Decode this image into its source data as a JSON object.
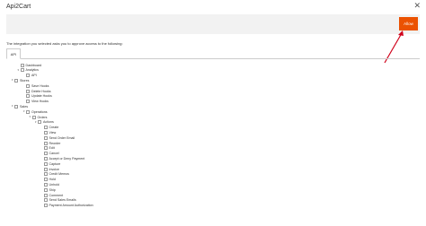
{
  "modal": {
    "title": "Api2Cart",
    "close_glyph": "✕"
  },
  "actions": {
    "allow_label": "Allow"
  },
  "intro_text": "The integration you selected asks you to approve access to the following:",
  "tabs": [
    {
      "label": "API"
    }
  ],
  "tree": [
    {
      "label": "Dashboard",
      "level": 1,
      "caret": false
    },
    {
      "label": "Analytics",
      "level": 1,
      "caret": true
    },
    {
      "label": "API",
      "level": 2,
      "caret": false
    },
    {
      "label": "Stores",
      "level": 0,
      "caret": true
    },
    {
      "label": "Save Hooks",
      "level": 2,
      "caret": false
    },
    {
      "label": "Delete Hooks",
      "level": 2,
      "caret": false
    },
    {
      "label": "Update Hooks",
      "level": 2,
      "caret": false
    },
    {
      "label": "View Hooks",
      "level": 2,
      "caret": false
    },
    {
      "label": "Sales",
      "level": 0,
      "caret": true
    },
    {
      "label": "Operations",
      "level": 2,
      "caret": true
    },
    {
      "label": "Orders",
      "level": 3,
      "caret": true
    },
    {
      "label": "Actions",
      "level": 4,
      "caret": true
    },
    {
      "label": "Create",
      "level": 5,
      "caret": false
    },
    {
      "label": "View",
      "level": 5,
      "caret": false
    },
    {
      "label": "Send Order Email",
      "level": 5,
      "caret": false
    },
    {
      "label": "Reorder",
      "level": 5,
      "caret": false
    },
    {
      "label": "Edit",
      "level": 5,
      "caret": false
    },
    {
      "label": "Cancel",
      "level": 5,
      "caret": false
    },
    {
      "label": "Accept or Deny Payment",
      "level": 5,
      "caret": false
    },
    {
      "label": "Capture",
      "level": 5,
      "caret": false
    },
    {
      "label": "Invoice",
      "level": 5,
      "caret": false
    },
    {
      "label": "Credit Memos",
      "level": 5,
      "caret": false
    },
    {
      "label": "Hold",
      "level": 5,
      "caret": false
    },
    {
      "label": "Unhold",
      "level": 5,
      "caret": false
    },
    {
      "label": "Ship",
      "level": 5,
      "caret": false
    },
    {
      "label": "Comment",
      "level": 5,
      "caret": false
    },
    {
      "label": "Send Sales Emails",
      "level": 5,
      "caret": false
    },
    {
      "label": "Payment Amount Authorization",
      "level": 5,
      "caret": false
    }
  ],
  "colors": {
    "accent": "#eb5202",
    "annotation_arrow": "#d0021b",
    "bar_bg": "#f2f2f2"
  }
}
